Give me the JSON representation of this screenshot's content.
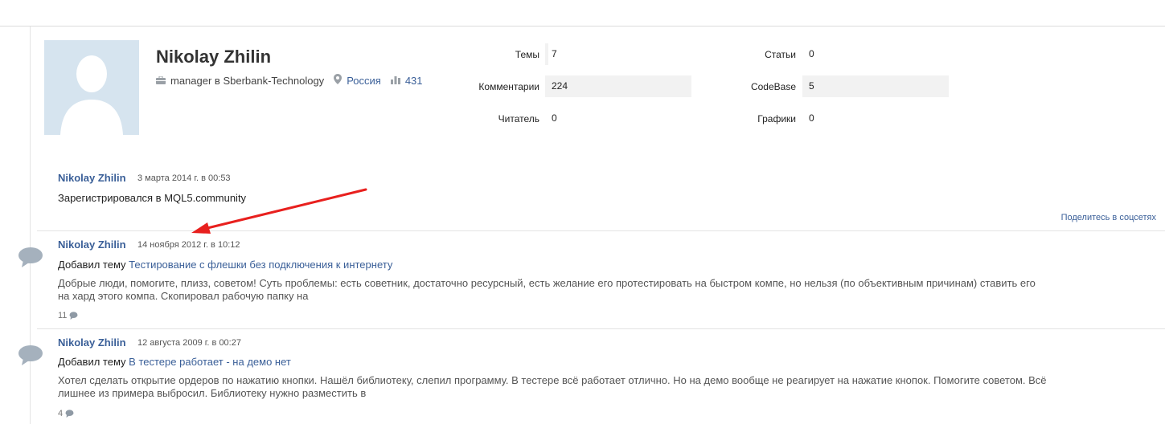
{
  "profile": {
    "name": "Nikolay Zhilin",
    "position": "manager в Sberbank-Technology",
    "country": "Россия",
    "rating": "431",
    "icons": {
      "position": "briefcase-icon",
      "country": "location-pin-icon",
      "rating": "bar-chart-icon"
    }
  },
  "stats": {
    "topics_label": "Темы",
    "topics_value": "7",
    "comments_label": "Комментарии",
    "comments_value": "224",
    "readers_label": "Читатель",
    "readers_value": "0",
    "articles_label": "Статьи",
    "articles_value": "0",
    "codebase_label": "CodeBase",
    "codebase_value": "5",
    "charts_label": "Графики",
    "charts_value": "0"
  },
  "feed": [
    {
      "author": "Nikolay Zhilin",
      "date": "3 марта 2014 г. в 00:53",
      "text": "Зарегистрировался в MQL5.community",
      "share": "Поделитесь в соцсетях"
    },
    {
      "author": "Nikolay Zhilin",
      "date": "14 ноября 2012 г. в 10:12",
      "action_prefix": "Добавил тему",
      "topic": "Тестирование с флешки без подключения к интернету",
      "excerpt_line1": "Добрые люди, помогите, плизз, советом! Суть проблемы: есть советник, достаточно ресурсный, есть желание его протестировать на быстром компе, но нельзя (по объективным причинам) ставить его",
      "excerpt_line2": "на хард этого компа. Скопировал рабочую папку на",
      "comments": "11"
    },
    {
      "author": "Nikolay Zhilin",
      "date": "12 августа 2009 г. в 00:27",
      "action_prefix": "Добавил тему",
      "topic": "В тестере работает - на демо нет",
      "excerpt_line1": "Хотел сделать открытие ордеров по нажатию кнопки. Нашёл библиотеку, слепил программу. В тестере всё работает отлично. Но на демо вообще не реагирует на нажатие кнопок. Помогите советом. Всё",
      "excerpt_line2": "лишнее из примера выбросил. Библиотеку нужно разместить в",
      "comments": "4"
    }
  ],
  "colors": {
    "link": "#3a5f98",
    "arrow": "#e8201e",
    "avatar_bg": "#d6e4ef",
    "stat_shade": "#f2f2f2"
  }
}
